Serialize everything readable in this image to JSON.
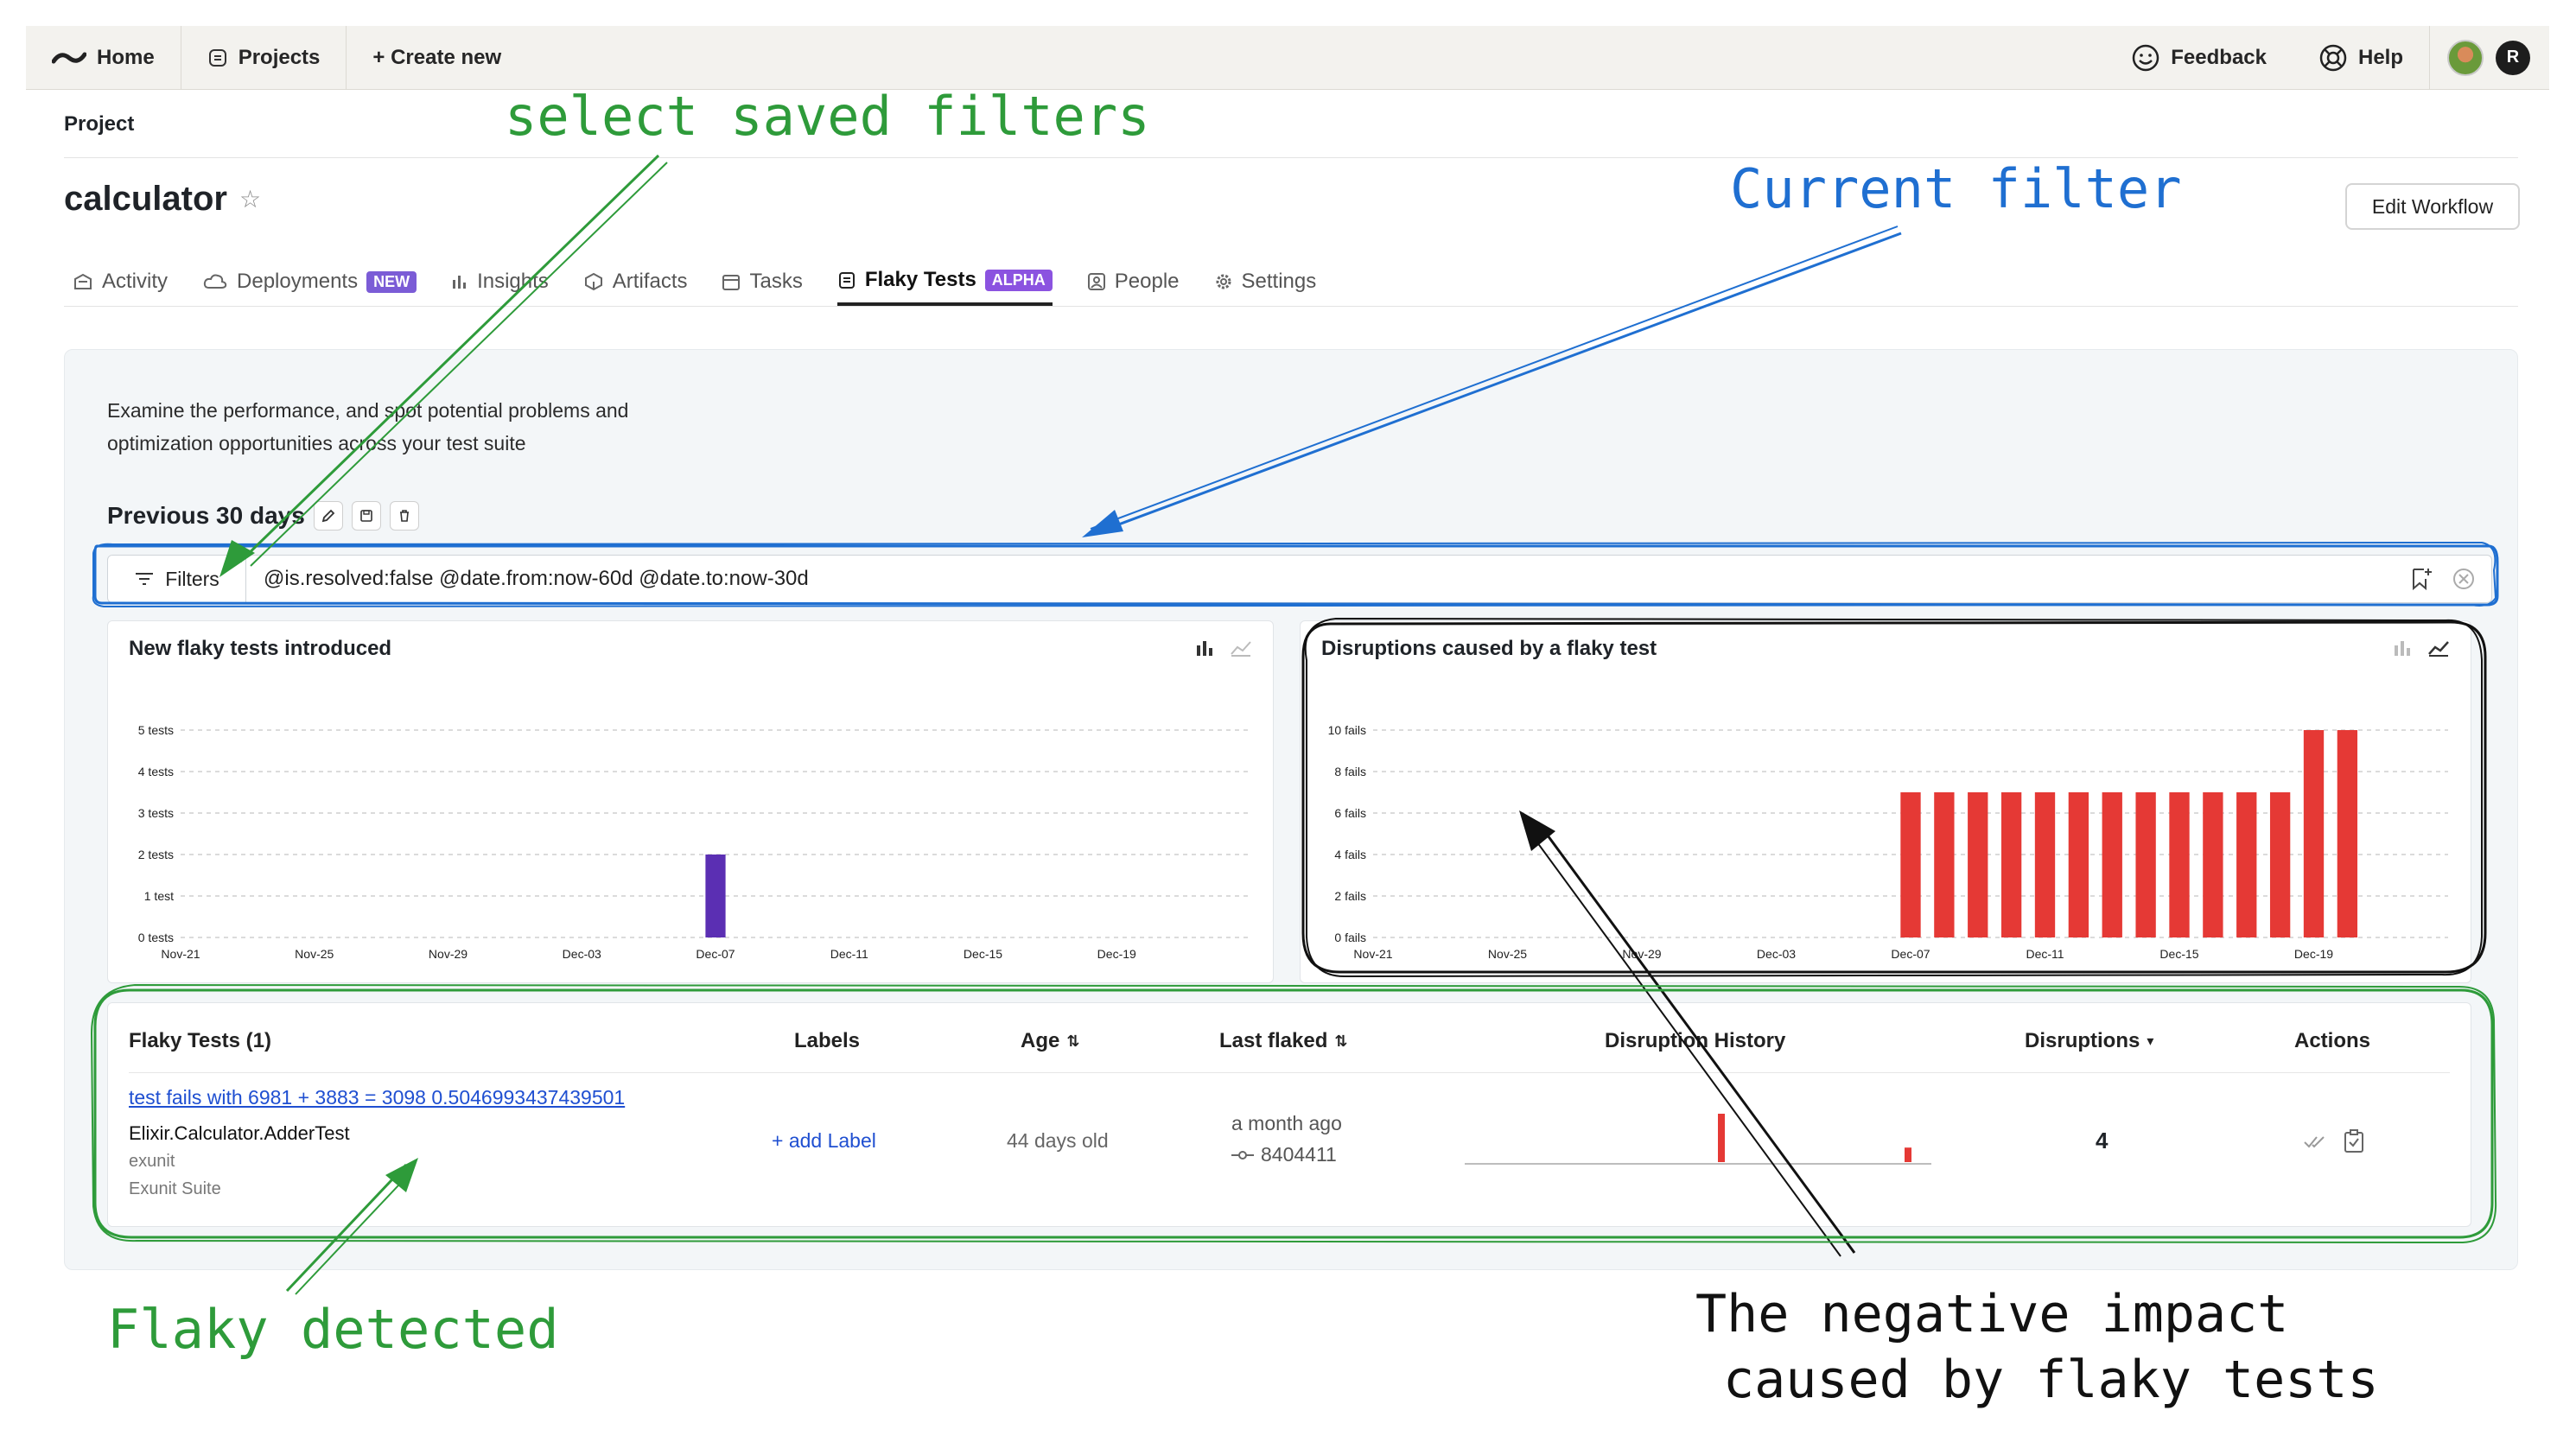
{
  "nav": {
    "home": "Home",
    "projects": "Projects",
    "create_new": "+ Create new",
    "feedback": "Feedback",
    "help": "Help",
    "avatar_letter": "R"
  },
  "breadcrumb": "Project",
  "project": {
    "name": "calculator",
    "edit_workflow": "Edit Workflow"
  },
  "tabs": [
    {
      "label": "Activity",
      "icon": "building-icon"
    },
    {
      "label": "Deployments",
      "icon": "cloud-icon",
      "badge": "NEW",
      "badge_color": "#7b5cd6"
    },
    {
      "label": "Insights",
      "icon": "bar-chart-icon"
    },
    {
      "label": "Artifacts",
      "icon": "box-icon"
    },
    {
      "label": "Tasks",
      "icon": "calendar-icon"
    },
    {
      "label": "Flaky Tests",
      "icon": "clipboard-icon",
      "badge": "ALPHA",
      "badge_color": "#8b53e0",
      "active": true
    },
    {
      "label": "People",
      "icon": "person-icon"
    },
    {
      "label": "Settings",
      "icon": "gear-icon"
    }
  ],
  "description": "Examine the performance, and spot potential problems and optimization opportunities across your test suite",
  "period_title": "Previous 30 days",
  "filter": {
    "button_label": "Filters",
    "query": "@is.resolved:false @date.from:now-60d @date.to:now-30d"
  },
  "chart_data": [
    {
      "type": "bar",
      "title": "New flaky tests introduced",
      "ytick_labels": [
        "0 tests",
        "1 test",
        "2 tests",
        "3 tests",
        "4 tests",
        "5 tests"
      ],
      "ylim": [
        0,
        5
      ],
      "xtick_labels": [
        "Nov-21",
        "Nov-25",
        "Nov-29",
        "Dec-03",
        "Dec-07",
        "Dec-11",
        "Dec-15",
        "Dec-19"
      ],
      "x_range": [
        "Nov-21",
        "Dec-23"
      ],
      "bars": [
        {
          "x": "Dec-07",
          "value": 2
        }
      ],
      "color": "#5b2fb3",
      "grid": true
    },
    {
      "type": "bar",
      "title": "Disruptions caused by a flaky test",
      "ytick_labels": [
        "0 fails",
        "2 fails",
        "4 fails",
        "6 fails",
        "8 fails",
        "10 fails"
      ],
      "ylim": [
        0,
        10
      ],
      "xtick_labels": [
        "Nov-21",
        "Nov-25",
        "Nov-29",
        "Dec-03",
        "Dec-07",
        "Dec-11",
        "Dec-15",
        "Dec-19"
      ],
      "x_range": [
        "Nov-21",
        "Dec-23"
      ],
      "bars": [
        {
          "x": "Dec-07",
          "value": 7
        },
        {
          "x": "Dec-08",
          "value": 7
        },
        {
          "x": "Dec-09",
          "value": 7
        },
        {
          "x": "Dec-10",
          "value": 7
        },
        {
          "x": "Dec-11",
          "value": 7
        },
        {
          "x": "Dec-12",
          "value": 7
        },
        {
          "x": "Dec-13",
          "value": 7
        },
        {
          "x": "Dec-14",
          "value": 7
        },
        {
          "x": "Dec-15",
          "value": 7
        },
        {
          "x": "Dec-16",
          "value": 7
        },
        {
          "x": "Dec-17",
          "value": 7
        },
        {
          "x": "Dec-18",
          "value": 7
        },
        {
          "x": "Dec-19",
          "value": 10
        },
        {
          "x": "Dec-20",
          "value": 10
        }
      ],
      "color": "#e53935",
      "grid": true
    }
  ],
  "table": {
    "headers": {
      "flaky_tests": "Flaky Tests (1)",
      "labels": "Labels",
      "age": "Age",
      "last_flaked": "Last flaked",
      "history": "Disruption History",
      "disruptions": "Disruptions",
      "actions": "Actions"
    },
    "row": {
      "test_name": "test fails with 6981 + 3883 = 3098 0.5046993437439501",
      "module": "Elixir.Calculator.AdderTest",
      "framework": "exunit",
      "suite": "Exunit Suite",
      "add_label": "+ add Label",
      "age": "44 days old",
      "last_flaked": "a month ago",
      "commit": "8404411",
      "disruptions": "4",
      "history": [
        {
          "position": 0.55,
          "value": 1.0
        },
        {
          "position": 0.95,
          "value": 0.3
        }
      ]
    }
  },
  "annotations": {
    "saved_filters": "select saved filters",
    "current_filter": "Current filter",
    "flaky_detected": "Flaky detected",
    "impact_line1": "The negative impact",
    "impact_line2": "caused by flaky tests",
    "colors": {
      "green": "#2e9b3a",
      "blue": "#1f6fd1",
      "black": "#111111"
    }
  }
}
